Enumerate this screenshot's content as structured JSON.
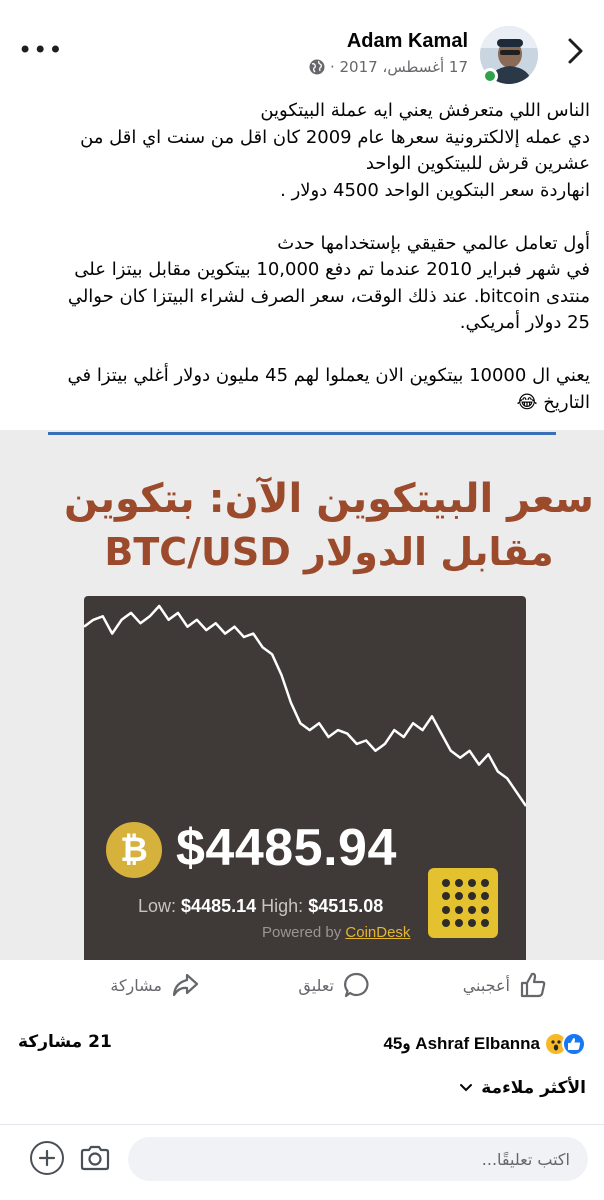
{
  "header": {
    "author": "Adam Kamal",
    "date": "17 أغسطس، 2017 ·",
    "more_icon": "more-icon",
    "back_icon": "chevron-right-icon"
  },
  "post": {
    "lines": [
      "الناس اللي متعرفش يعني ايه عملة البيتكوين",
      "دي عمله  إلالكترونية سعرها عام 2009 كان اقل من سنت اي اقل من",
      "عشرين قرش  للبيتكوين الواحد",
      "انهاردة سعر البتكوين الواحد 4500 دولار .",
      "",
      "أول تعامل عالمي حقيقي بإستخدامها حدث",
      "في شهر فبراير 2010 عندما تم دفع 10,000 بيتكوين مقابل بيتزا على",
      "منتدى bitcoin. عند ذلك الوقت، سعر الصرف لشراء البيتزا كان حوالي",
      "25 دولار أمريكي.",
      "",
      "يعني ال 10000 بيتكوين الان يعملوا لهم 45 مليون دولار أغلي بيتزا في",
      "التاريخ 😂"
    ]
  },
  "image": {
    "title_line1": "سعر البيتكوين الآن: بتكوين",
    "title_line2": "مقابل الدولار BTC/USD",
    "coin_symbol": "₿",
    "price": "$4485.94",
    "low_label": "Low:",
    "low_value": "$4485.14",
    "high_label": "High:",
    "high_value": "$4515.08",
    "powered_label": "Powered by",
    "powered_brand": "CoinDesk",
    "line_color": "#ffffff",
    "bg_color": "#3f3937"
  },
  "chart_data": {
    "type": "line",
    "title": "",
    "xlabel": "",
    "ylabel": "",
    "series": [
      {
        "values": [
          4512,
          4513,
          4513.5,
          4511,
          4513,
          4514,
          4512.5,
          4513.5,
          4515,
          4513,
          4514,
          4512,
          4513,
          4511.5,
          4512.5,
          4511,
          4512,
          4510.5,
          4511,
          4509,
          4508,
          4505,
          4501,
          4498,
          4497,
          4498,
          4496,
          4497,
          4496.5,
          4495,
          4495.5,
          4494,
          4495,
          4497,
          4496,
          4498,
          4497,
          4499,
          4496.5,
          4494,
          4493,
          4494,
          4492,
          4493.5,
          4491,
          4490,
          4488,
          4486
        ]
      }
    ]
  },
  "actions": {
    "like": "أعجبني",
    "comment": "تعليق",
    "share": "مشاركة"
  },
  "reactions": {
    "summary": "Ashraf Elbanna و45",
    "shares": "21 مشاركة",
    "like_color": "#1877f2",
    "wow_color": "#f7b928"
  },
  "sort": {
    "label": "الأكثر ملاءمة"
  },
  "composer": {
    "placeholder": "اكتب تعليقًا..."
  }
}
